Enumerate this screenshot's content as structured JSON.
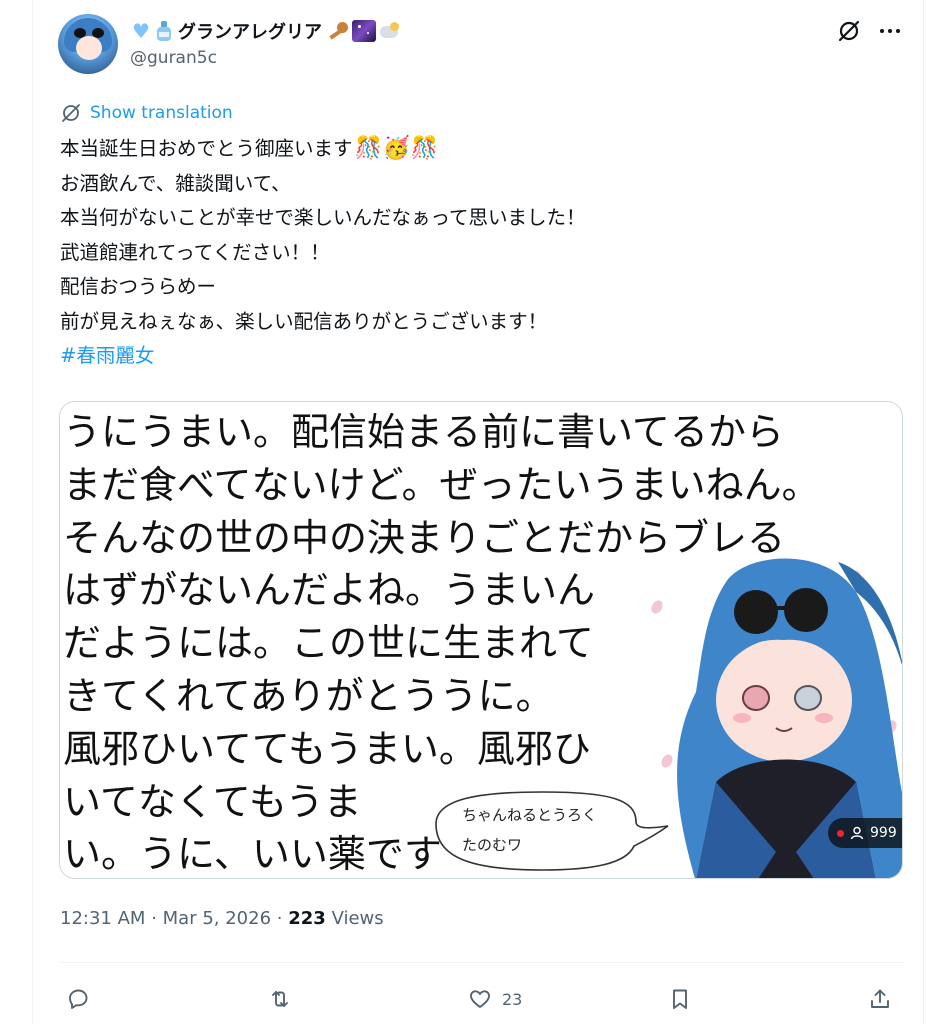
{
  "user": {
    "display_name": "グランアレグリア",
    "handle": "@guran5c",
    "name_emoji_icons": [
      "blue-heart-icon",
      "sake-bottle-icon",
      "key-icon",
      "night-sky-icon",
      "moon-viewing-icon"
    ]
  },
  "translate_label": "Show translation",
  "tweet": {
    "lines": [
      "本当誕生日おめでとう御座います",
      "お酒飲んで、雑談聞いて、",
      "本当何がないことが幸せで楽しいんだなぁって思いました！",
      "武道館連れてってください！！",
      "配信おつうらめー",
      "前が見えねぇなぁ、楽しい配信ありがとうございます！"
    ],
    "line1_emojis": [
      "🎊",
      "🥳",
      "🎊"
    ],
    "hashtag": "#春雨麗女"
  },
  "media": {
    "text_lines": [
      "うにうまい。配信始まる前に書いてるから",
      "まだ食べてないけど。ぜったいうまいねん。",
      "そんなの世の中の決まりごとだからブレる",
      "はずがないんだよね。うまいん",
      "だようには。この世に生まれて",
      "きてくれてありがとううに。",
      "風邪ひいててもうまい。風邪ひ",
      "いてなくてもうま",
      "い。うに、いい薬です"
    ],
    "speech_bubble_lines": [
      "ちゃんねるとうろく",
      "たのむワ"
    ],
    "view_count": "999"
  },
  "meta": {
    "time": "12:31 AM",
    "separator": "·",
    "date": "Mar 5, 2026",
    "views_count": "223",
    "views_label": "Views"
  },
  "actions": {
    "like_count": "23"
  },
  "colors": {
    "link_blue": "#1d9bf0",
    "secondary_text": "#536471",
    "primary_text": "#0f1419",
    "border": "#cfd9de"
  }
}
